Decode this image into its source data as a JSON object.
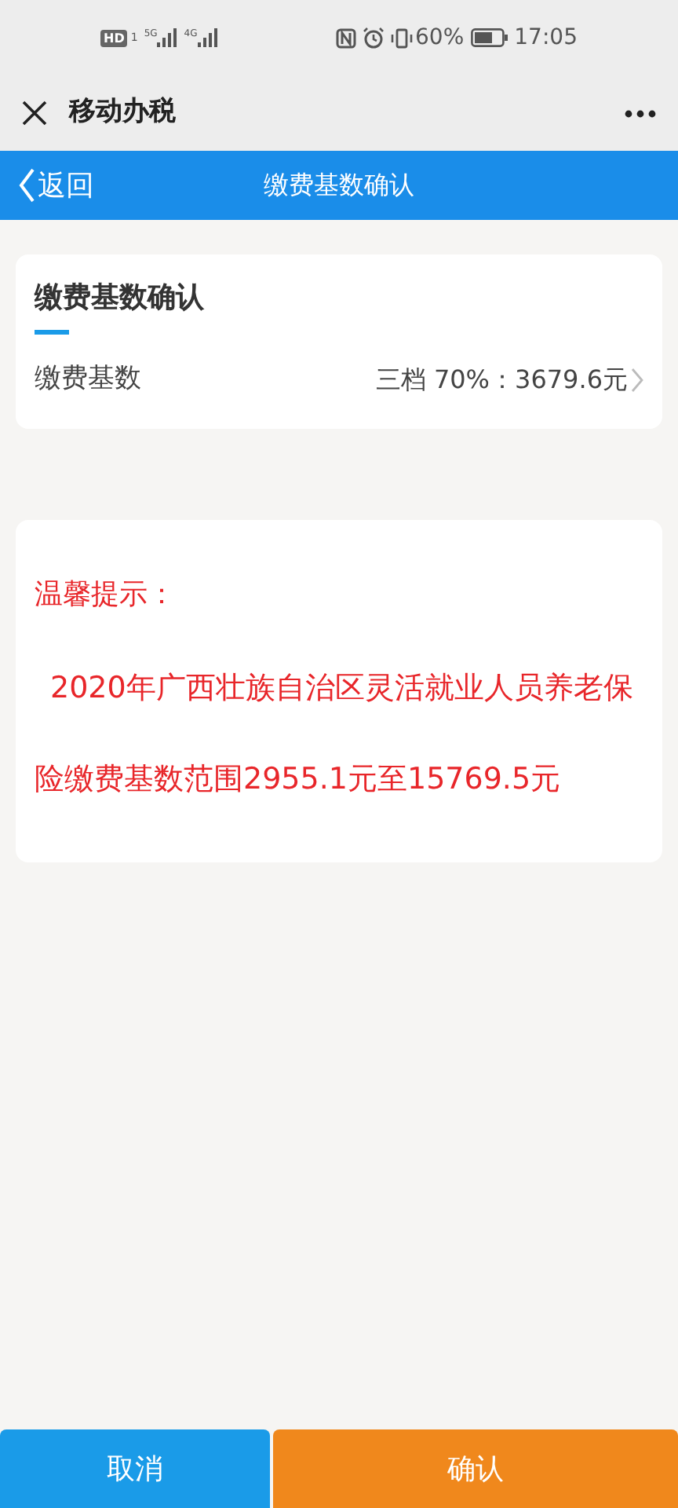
{
  "status_bar": {
    "hd": "HD",
    "sim": "1",
    "networks": [
      "5G",
      "4G"
    ],
    "battery": "60%",
    "time": "17:05"
  },
  "app_bar": {
    "title": "移动办税"
  },
  "header": {
    "back": "返回",
    "title": "缴费基数确认"
  },
  "card": {
    "title": "缴费基数确认",
    "row": {
      "label": "缴费基数",
      "value": "三档 70%：3679.6元"
    }
  },
  "notice": {
    "title": "温馨提示：",
    "text": "2020年广西壮族自治区灵活就业人员养老保险缴费基数范围2955.1元至15769.5元"
  },
  "buttons": [
    {
      "label": "取消",
      "kind": "cancel"
    },
    {
      "label": "确认",
      "kind": "confirm"
    }
  ]
}
